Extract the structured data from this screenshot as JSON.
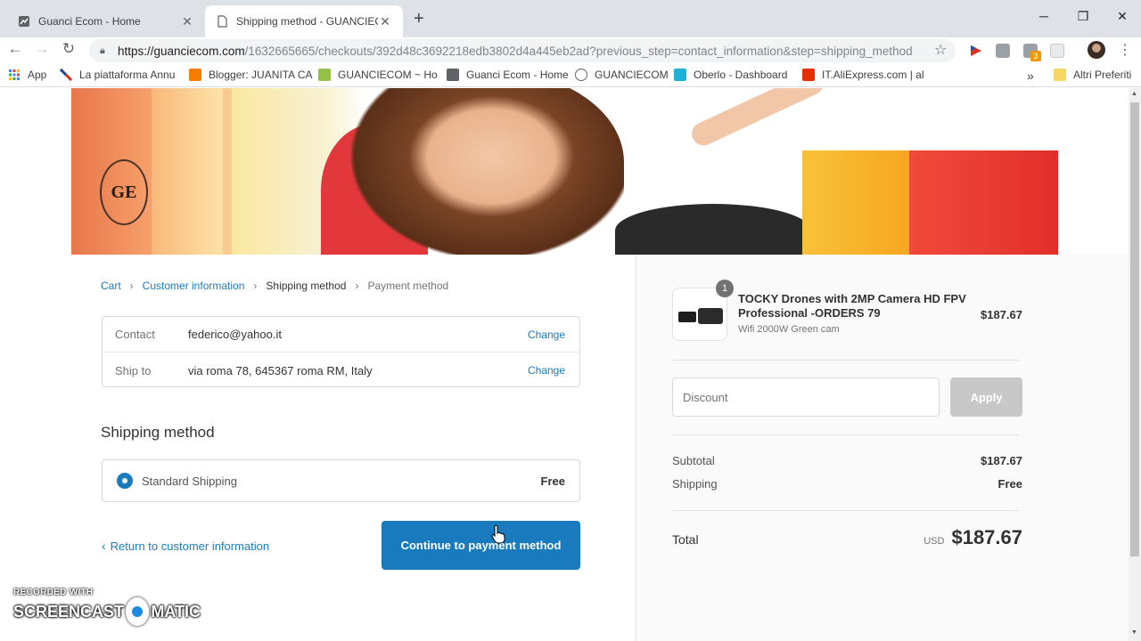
{
  "browser": {
    "tabs": [
      {
        "title": "Guanci Ecom - Home",
        "active": false
      },
      {
        "title": "Shipping method - GUANCIECOM",
        "active": true
      }
    ],
    "url_host": "https://guanciecom.com",
    "url_rest": "/1632665665/checkouts/392d48c3692218edb3802d4a445eb2ad?previous_step=contact_information&step=shipping_method",
    "bookmarks": [
      {
        "label": "App",
        "icon": "apps-grid-icon"
      },
      {
        "label": "La piattaforma Annu",
        "icon": "flag-icon"
      },
      {
        "label": "Blogger: JUANITA CA",
        "icon": "blogger-icon"
      },
      {
        "label": "GUANCIECOM ~ Ho",
        "icon": "shopify-icon"
      },
      {
        "label": "Guanci Ecom - Home",
        "icon": "page-icon"
      },
      {
        "label": "GUANCIECOM",
        "icon": "site-icon"
      },
      {
        "label": "Oberlo - Dashboard",
        "icon": "oberlo-icon"
      },
      {
        "label": "IT.AliExpress.com | al",
        "icon": "aliexpress-icon"
      }
    ],
    "more_bookmarks": "»",
    "other_bookmarks": "Altri Preferiti",
    "extension_badge": "3"
  },
  "banner": {
    "logo_text": "GE"
  },
  "breadcrumb": {
    "cart": "Cart",
    "customer_information": "Customer information",
    "shipping_method": "Shipping method",
    "payment_method": "Payment method"
  },
  "review": {
    "contact_label": "Contact",
    "contact_value": "federico@yahoo.it",
    "ship_to_label": "Ship to",
    "ship_to_value": "via roma 78, 645367 roma RM, Italy",
    "change_label": "Change"
  },
  "shipping": {
    "section_title": "Shipping method",
    "option_name": "Standard Shipping",
    "option_price": "Free"
  },
  "actions": {
    "return_label": "Return to customer information",
    "continue_label": "Continue to payment method"
  },
  "order": {
    "product_name": "TOCKY Drones with 2MP Camera HD FPV Professional -ORDERS 79",
    "product_variant": "Wifi 2000W Green cam",
    "product_price": "$187.67",
    "quantity": "1",
    "discount_placeholder": "Discount",
    "apply_label": "Apply",
    "subtotal_label": "Subtotal",
    "subtotal_value": "$187.67",
    "shipping_label": "Shipping",
    "shipping_value": "Free",
    "total_label": "Total",
    "currency": "USD",
    "total_value": "$187.67"
  },
  "watermark": {
    "top": "RECORDED WITH",
    "left": "SCREENCAST",
    "right": "MATIC"
  },
  "colors": {
    "accent": "#197bbd",
    "apply_disabled": "#c8c8c8"
  }
}
